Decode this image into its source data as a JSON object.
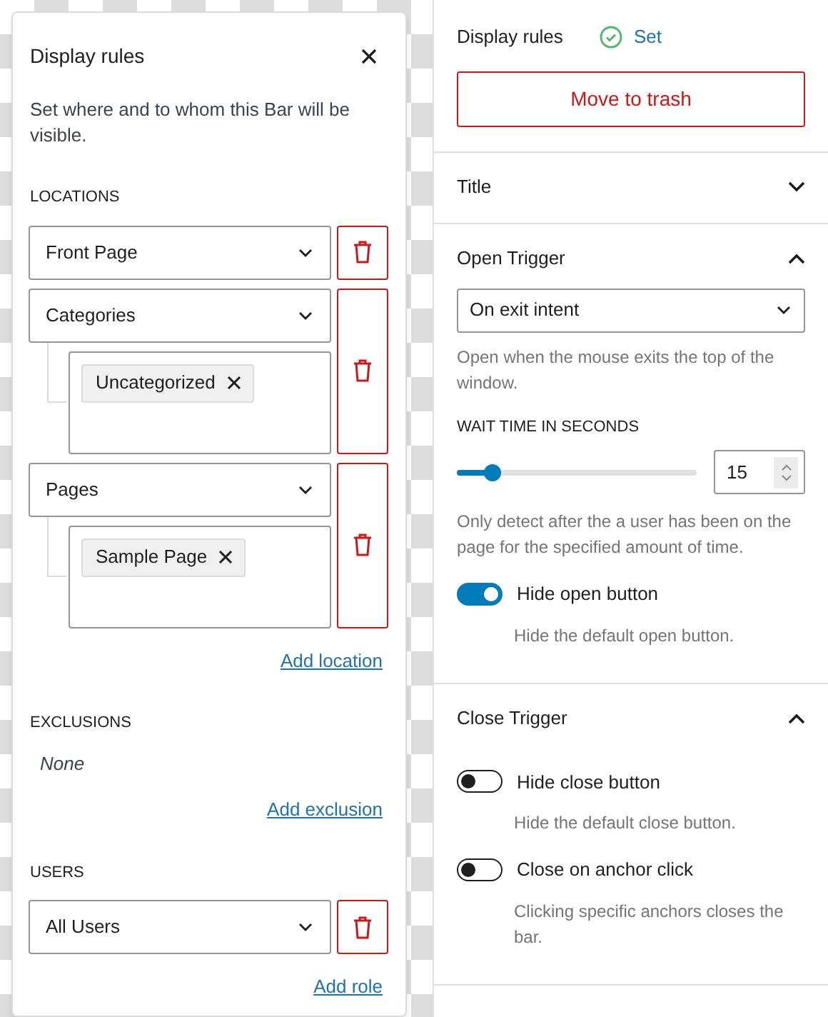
{
  "popover": {
    "title": "Display rules",
    "description": "Set where and to whom this Bar will be visible.",
    "sections": [
      {
        "heading": "LOCATIONS",
        "rules": [
          {
            "value": "Front Page"
          },
          {
            "value": "Categories",
            "tags": [
              "Uncategorized"
            ]
          },
          {
            "value": "Pages",
            "tags": [
              "Sample Page"
            ]
          }
        ],
        "add_link": "Add location"
      },
      {
        "heading": "EXCLUSIONS",
        "empty_text": "None",
        "add_link": "Add exclusion"
      },
      {
        "heading": "USERS",
        "rules": [
          {
            "value": "All Users"
          }
        ],
        "add_link": "Add role"
      }
    ]
  },
  "sidebar": {
    "display_rules": {
      "label": "Display rules",
      "status": "Set"
    },
    "trash_button": "Move to trash",
    "panels": [
      {
        "title": "Title",
        "expanded": false
      },
      {
        "title": "Open Trigger",
        "expanded": true,
        "controls": [
          {
            "kind": "select",
            "value": "On exit intent",
            "help": "Open when the mouse exits the top of the window."
          },
          {
            "kind": "slider",
            "label": "WAIT TIME IN SECONDS",
            "level": 0.15,
            "value": "15",
            "help": "Only detect after the a user has been on the page for the specified amount of time."
          },
          {
            "kind": "toggle",
            "label": "Hide open button",
            "on": true,
            "help": "Hide the default open button."
          }
        ]
      },
      {
        "title": "Close Trigger",
        "expanded": true,
        "controls": [
          {
            "kind": "toggle",
            "label": "Hide close button",
            "on": false,
            "help": "Hide the default close button."
          },
          {
            "kind": "toggle",
            "label": "Close on anchor click",
            "on": false,
            "help": "Clicking specific anchors closes the bar."
          }
        ]
      }
    ]
  }
}
